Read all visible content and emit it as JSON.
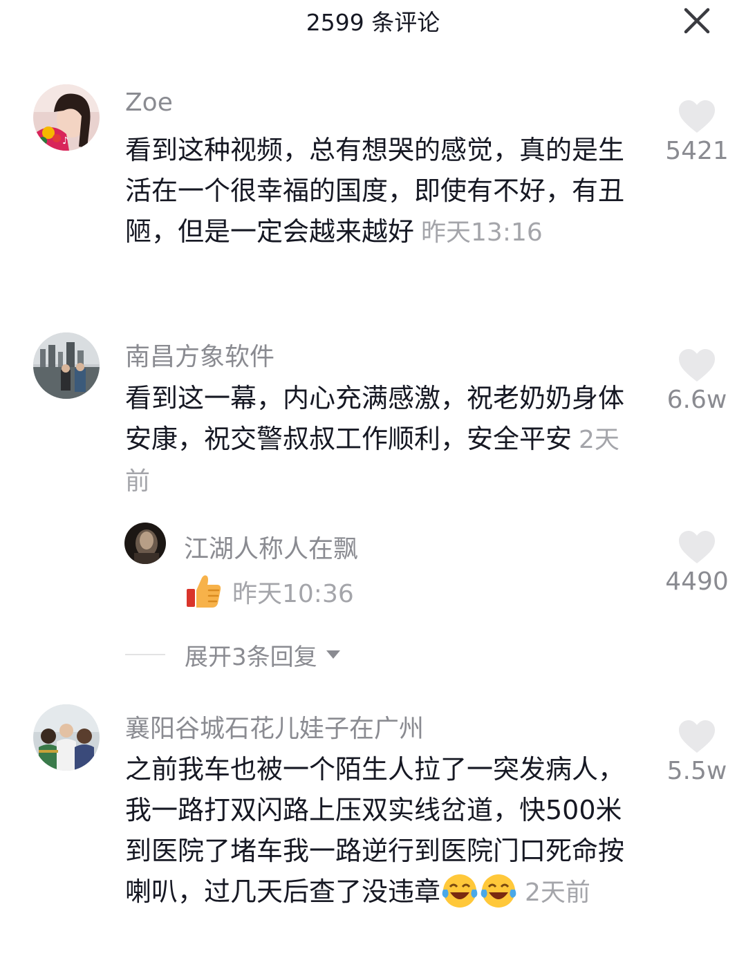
{
  "header": {
    "title": "2599 条评论",
    "close_icon": "close-icon"
  },
  "comments": [
    {
      "username": "Zoe",
      "text": "看到这种视频，总有想哭的感觉，真的是生活在一个很幸福的国度，即使有不好，有丑陋，但是一定会越来越好",
      "time": "昨天13:16",
      "likes": "5421"
    },
    {
      "username": "南昌方象软件",
      "text": "看到这一幕，内心充满感激，祝老奶奶身体安康，祝交警叔叔工作顺利，安全平安",
      "time": "2天前",
      "likes": "6.6w",
      "reply": {
        "username": "江湖人称人在飘",
        "emoji": "thumbs-up-icon",
        "time": "昨天10:36",
        "likes": "4490"
      },
      "expand_label": "展开3条回复"
    },
    {
      "username": "襄阳谷城石花儿娃子在广州",
      "text": "之前我车也被一个陌生人拉了一突发病人，我一路打双闪路上压双实线岔道，快500米到医院了堵车我一路逆行到医院门口死命按喇叭，过几天后查了没违章",
      "emoji": "laughing-tears-icon",
      "time": "2天前",
      "likes": "5.5w"
    }
  ],
  "colors": {
    "text_primary": "#161823",
    "text_secondary": "#8a8b91",
    "text_time": "#a4a5aa",
    "heart": "#e8e8ea"
  }
}
